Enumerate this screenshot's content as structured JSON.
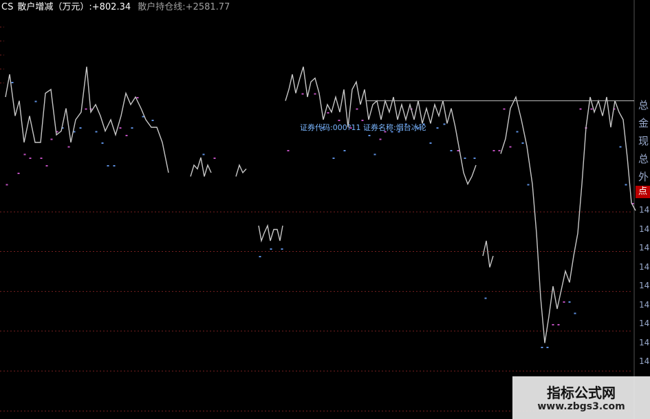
{
  "header": {
    "series_code": "CS",
    "label1": "散户增减（万元）:",
    "value1": "+802.34",
    "label2": "散户持仓线:",
    "value2": "+2581.77",
    "colors": {
      "code": "#ffffff",
      "label1": "#ffffff",
      "value1": "#ffffff",
      "label2": "#a0a0a0",
      "value2": "#a0a0a0"
    }
  },
  "tooltip": {
    "text": "证券代码:000?11 证券名称:烟台冰轮"
  },
  "right_panel": {
    "labels": [
      "总",
      "金",
      "现",
      "总",
      "外"
    ],
    "badge": "点",
    "ticks": [
      "14",
      "14",
      "14",
      "14",
      "14",
      "14",
      "14",
      "14",
      "14"
    ]
  },
  "watermark": {
    "title": "指标公式网",
    "url": "www.zbgs3.com"
  },
  "chart_data": {
    "type": "bar",
    "ylim": [
      0,
      100
    ],
    "grid": true,
    "colors": {
      "up": "#c050c0",
      "down": "#5d8fe0",
      "line": "#c8c8c8",
      "grid": "#7a2020"
    },
    "bars": [
      {
        "x": 10,
        "top": 55,
        "bottom": 62,
        "c": "u"
      },
      {
        "x": 18,
        "top": 82,
        "bottom": 92,
        "c": "d"
      },
      {
        "x": 27,
        "top": 58,
        "bottom": 75,
        "c": "u"
      },
      {
        "x": 36,
        "top": 63,
        "bottom": 75,
        "c": "u"
      },
      {
        "x": 44,
        "top": 62,
        "bottom": 68,
        "c": "u"
      },
      {
        "x": 52,
        "top": 77,
        "bottom": 86,
        "c": "d"
      },
      {
        "x": 60,
        "top": 62,
        "bottom": 68,
        "c": "u"
      },
      {
        "x": 68,
        "top": 60,
        "bottom": 67,
        "c": "u"
      },
      {
        "x": 75,
        "top": 67,
        "bottom": 73,
        "c": "u"
      },
      {
        "x": 83,
        "top": 69,
        "bottom": 76,
        "c": "u"
      },
      {
        "x": 91,
        "top": 70,
        "bottom": 80,
        "c": "d"
      },
      {
        "x": 100,
        "top": 65,
        "bottom": 72,
        "c": "u"
      },
      {
        "x": 108,
        "top": 69,
        "bottom": 78,
        "c": "d"
      },
      {
        "x": 117,
        "top": 70,
        "bottom": 83,
        "c": "d"
      },
      {
        "x": 125,
        "top": 75,
        "bottom": 80,
        "c": "u"
      },
      {
        "x": 132,
        "top": 75,
        "bottom": 81,
        "c": "u"
      },
      {
        "x": 140,
        "top": 69,
        "bottom": 76,
        "c": "d"
      },
      {
        "x": 149,
        "top": 66,
        "bottom": 74,
        "c": "d"
      },
      {
        "x": 157,
        "top": 60,
        "bottom": 67,
        "c": "d"
      },
      {
        "x": 166,
        "top": 60,
        "bottom": 67,
        "c": "d"
      },
      {
        "x": 175,
        "top": 70,
        "bottom": 78,
        "c": "u"
      },
      {
        "x": 184,
        "top": 68,
        "bottom": 75,
        "c": "u"
      },
      {
        "x": 192,
        "top": 70,
        "bottom": 77,
        "c": "d"
      },
      {
        "x": 200,
        "top": 78,
        "bottom": 84,
        "c": "u"
      },
      {
        "x": 208,
        "top": 73,
        "bottom": 79,
        "c": "d"
      },
      {
        "x": 222,
        "top": 72,
        "bottom": 81,
        "c": "d"
      },
      {
        "x": 296,
        "top": 63,
        "bottom": 68,
        "c": "d"
      },
      {
        "x": 312,
        "top": 62,
        "bottom": 68,
        "c": "u"
      },
      {
        "x": 378,
        "top": 36,
        "bottom": 45,
        "c": "d"
      },
      {
        "x": 394,
        "top": 38,
        "bottom": 43,
        "c": "d"
      },
      {
        "x": 410,
        "top": 38,
        "bottom": 42,
        "c": "d"
      },
      {
        "x": 419,
        "top": 64,
        "bottom": 72,
        "c": "u"
      },
      {
        "x": 440,
        "top": 79,
        "bottom": 90,
        "c": "u"
      },
      {
        "x": 458,
        "top": 79,
        "bottom": 87,
        "c": "u"
      },
      {
        "x": 468,
        "top": 70,
        "bottom": 80,
        "c": "d"
      },
      {
        "x": 477,
        "top": 74,
        "bottom": 82,
        "c": "u"
      },
      {
        "x": 485,
        "top": 62,
        "bottom": 70,
        "c": "d"
      },
      {
        "x": 493,
        "top": 72,
        "bottom": 80,
        "c": "u"
      },
      {
        "x": 501,
        "top": 64,
        "bottom": 75,
        "c": "d"
      },
      {
        "x": 510,
        "top": 70,
        "bottom": 78,
        "c": "u"
      },
      {
        "x": 519,
        "top": 75,
        "bottom": 84,
        "c": "u"
      },
      {
        "x": 527,
        "top": 72,
        "bottom": 82,
        "c": "u"
      },
      {
        "x": 537,
        "top": 68,
        "bottom": 75,
        "c": "d"
      },
      {
        "x": 545,
        "top": 63,
        "bottom": 70,
        "c": "d"
      },
      {
        "x": 553,
        "top": 67,
        "bottom": 75,
        "c": "u"
      },
      {
        "x": 560,
        "top": 69,
        "bottom": 78,
        "c": "u"
      },
      {
        "x": 570,
        "top": 69,
        "bottom": 75,
        "c": "d"
      },
      {
        "x": 580,
        "top": 69,
        "bottom": 76,
        "c": "d"
      },
      {
        "x": 590,
        "top": 71,
        "bottom": 77,
        "c": "d"
      },
      {
        "x": 598,
        "top": 75,
        "bottom": 77,
        "c": "u"
      },
      {
        "x": 608,
        "top": 70,
        "bottom": 76,
        "c": "d"
      },
      {
        "x": 616,
        "top": 71,
        "bottom": 76,
        "c": "d"
      },
      {
        "x": 626,
        "top": 66,
        "bottom": 76,
        "c": "d"
      },
      {
        "x": 636,
        "top": 70,
        "bottom": 76,
        "c": "d"
      },
      {
        "x": 646,
        "top": 71,
        "bottom": 76,
        "c": "d"
      },
      {
        "x": 656,
        "top": 64,
        "bottom": 76,
        "c": "d"
      },
      {
        "x": 666,
        "top": 64,
        "bottom": 70,
        "c": "u"
      },
      {
        "x": 676,
        "top": 62,
        "bottom": 67,
        "c": "d"
      },
      {
        "x": 690,
        "top": 62,
        "bottom": 64,
        "c": "d"
      },
      {
        "x": 706,
        "top": 25,
        "bottom": 36,
        "c": "d"
      },
      {
        "x": 718,
        "top": 64,
        "bottom": 68,
        "c": "u"
      },
      {
        "x": 726,
        "top": 64,
        "bottom": 70,
        "c": "u"
      },
      {
        "x": 733,
        "top": 75,
        "bottom": 80,
        "c": "u"
      },
      {
        "x": 742,
        "top": 65,
        "bottom": 70,
        "c": "u"
      },
      {
        "x": 752,
        "top": 69,
        "bottom": 76,
        "c": "d"
      },
      {
        "x": 760,
        "top": 66,
        "bottom": 72,
        "c": "d"
      },
      {
        "x": 768,
        "top": 55,
        "bottom": 66,
        "c": "d"
      },
      {
        "x": 788,
        "top": 12,
        "bottom": 25,
        "c": "d"
      },
      {
        "x": 796,
        "top": 12,
        "bottom": 25,
        "c": "d"
      },
      {
        "x": 804,
        "top": 18,
        "bottom": 32,
        "c": "u"
      },
      {
        "x": 812,
        "top": 18,
        "bottom": 20,
        "c": "u"
      },
      {
        "x": 820,
        "top": 24,
        "bottom": 34,
        "c": "u"
      },
      {
        "x": 828,
        "top": 24,
        "bottom": 32,
        "c": "d"
      },
      {
        "x": 836,
        "top": 21,
        "bottom": 30,
        "c": "d"
      },
      {
        "x": 844,
        "top": 75,
        "bottom": 80,
        "c": "u"
      },
      {
        "x": 852,
        "top": 70,
        "bottom": 78,
        "c": "u"
      },
      {
        "x": 860,
        "top": 75,
        "bottom": 80,
        "c": "u"
      },
      {
        "x": 893,
        "top": 75,
        "bottom": 80,
        "c": "u"
      },
      {
        "x": 902,
        "top": 65,
        "bottom": 75,
        "c": "d"
      },
      {
        "x": 910,
        "top": 55,
        "bottom": 65,
        "c": "d"
      },
      {
        "x": 920,
        "top": 50,
        "bottom": 55,
        "c": "u"
      }
    ],
    "line_segments": [
      [
        [
          8,
          78
        ],
        [
          14,
          84
        ],
        [
          22,
          73
        ],
        [
          28,
          77
        ],
        [
          35,
          66
        ],
        [
          43,
          73
        ],
        [
          51,
          66
        ],
        [
          59,
          66
        ],
        [
          66,
          79
        ],
        [
          74,
          80
        ],
        [
          82,
          68
        ],
        [
          89,
          69
        ],
        [
          96,
          75
        ],
        [
          103,
          66
        ],
        [
          110,
          72
        ],
        [
          118,
          74
        ],
        [
          126,
          86
        ],
        [
          132,
          74
        ],
        [
          139,
          76
        ],
        [
          146,
          73
        ],
        [
          153,
          69
        ],
        [
          161,
          72
        ],
        [
          168,
          68
        ],
        [
          176,
          73
        ],
        [
          183,
          79
        ],
        [
          190,
          76
        ],
        [
          197,
          78
        ],
        [
          205,
          75
        ],
        [
          212,
          72
        ],
        [
          220,
          70
        ],
        [
          228,
          70
        ],
        [
          236,
          66
        ],
        [
          245,
          58
        ]
      ],
      [
        [
          277,
          57
        ],
        [
          282,
          60
        ],
        [
          287,
          59
        ],
        [
          292,
          62
        ],
        [
          297,
          57
        ],
        [
          302,
          60
        ],
        [
          307,
          58
        ]
      ],
      [
        [
          343,
          57
        ],
        [
          348,
          60
        ],
        [
          353,
          58
        ],
        [
          358,
          59
        ]
      ],
      [
        [
          376,
          44
        ],
        [
          380,
          40
        ],
        [
          384,
          42
        ],
        [
          389,
          44
        ],
        [
          393,
          40
        ],
        [
          398,
          43
        ],
        [
          403,
          43
        ],
        [
          407,
          40
        ],
        [
          411,
          44
        ]
      ],
      [
        [
          415,
          77
        ],
        [
          420,
          80
        ],
        [
          425,
          84
        ],
        [
          430,
          79
        ],
        [
          436,
          83
        ],
        [
          441,
          86
        ],
        [
          447,
          78
        ],
        [
          452,
          82
        ],
        [
          458,
          83
        ],
        [
          464,
          79
        ],
        [
          470,
          72
        ],
        [
          476,
          76
        ],
        [
          482,
          74
        ],
        [
          488,
          78
        ],
        [
          494,
          74
        ],
        [
          500,
          80
        ],
        [
          506,
          70
        ],
        [
          512,
          80
        ],
        [
          518,
          82
        ],
        [
          524,
          76
        ],
        [
          530,
          80
        ],
        [
          536,
          72
        ],
        [
          542,
          76
        ],
        [
          548,
          77
        ],
        [
          554,
          72
        ],
        [
          560,
          77
        ],
        [
          566,
          74
        ],
        [
          572,
          78
        ],
        [
          578,
          72
        ],
        [
          584,
          76
        ],
        [
          590,
          72
        ],
        [
          596,
          76
        ],
        [
          602,
          72
        ],
        [
          608,
          77
        ],
        [
          614,
          71
        ],
        [
          620,
          75
        ],
        [
          626,
          71
        ],
        [
          632,
          76
        ],
        [
          638,
          73
        ],
        [
          644,
          77
        ],
        [
          650,
          71
        ],
        [
          656,
          75
        ],
        [
          662,
          70
        ],
        [
          668,
          64
        ],
        [
          674,
          58
        ],
        [
          680,
          55
        ],
        [
          686,
          57
        ],
        [
          692,
          60
        ]
      ],
      [
        [
          702,
          36
        ],
        [
          707,
          40
        ],
        [
          712,
          33
        ],
        [
          717,
          36
        ]
      ],
      [
        [
          728,
          63
        ],
        [
          735,
          67
        ],
        [
          742,
          75
        ],
        [
          750,
          78
        ],
        [
          758,
          72
        ],
        [
          766,
          65
        ],
        [
          774,
          55
        ],
        [
          780,
          42
        ],
        [
          786,
          25
        ],
        [
          792,
          13
        ],
        [
          798,
          20
        ],
        [
          804,
          28
        ],
        [
          810,
          22
        ],
        [
          816,
          27
        ],
        [
          822,
          32
        ],
        [
          828,
          29
        ],
        [
          834,
          36
        ],
        [
          840,
          42
        ],
        [
          846,
          55
        ],
        [
          852,
          70
        ],
        [
          858,
          78
        ],
        [
          864,
          74
        ],
        [
          870,
          77
        ],
        [
          876,
          73
        ],
        [
          882,
          78
        ],
        [
          888,
          70
        ],
        [
          894,
          77
        ],
        [
          900,
          74
        ],
        [
          906,
          72
        ],
        [
          912,
          62
        ],
        [
          918,
          50
        ],
        [
          924,
          48
        ]
      ]
    ],
    "gridlines": [
      31.2,
      21.5,
      11.7,
      2.0,
      -7.8,
      -17.6,
      -27.4
    ],
    "upper_grid": [
      96.5,
      92.8,
      89.1,
      85.4,
      81.7
    ]
  }
}
